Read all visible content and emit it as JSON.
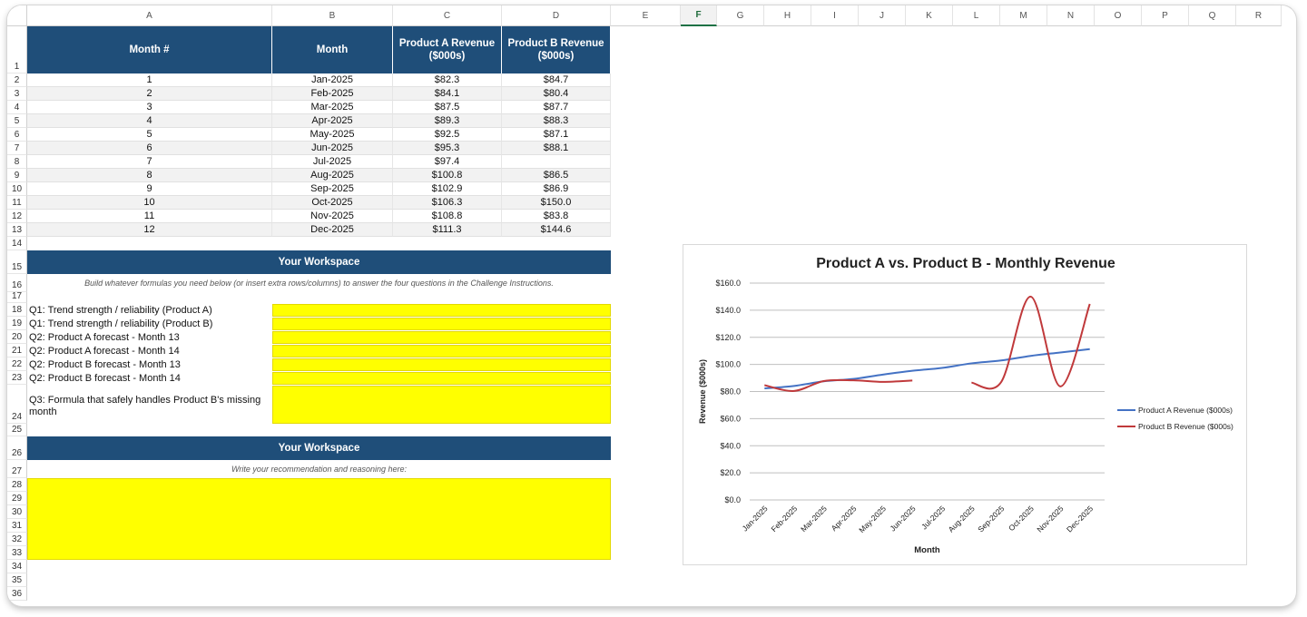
{
  "columns": [
    "A",
    "B",
    "C",
    "D",
    "E",
    "F",
    "G",
    "H",
    "I",
    "J",
    "K",
    "L",
    "M",
    "N",
    "O",
    "P",
    "Q",
    "R"
  ],
  "selected_column": "F",
  "rows": [
    "1",
    "2",
    "3",
    "4",
    "5",
    "6",
    "7",
    "8",
    "9",
    "10",
    "11",
    "12",
    "13",
    "14",
    "15",
    "16",
    "17",
    "18",
    "19",
    "20",
    "21",
    "22",
    "23",
    "24",
    "25",
    "26",
    "27",
    "28",
    "29",
    "30",
    "31",
    "32",
    "33",
    "34",
    "35",
    "36"
  ],
  "table": {
    "headers": [
      "Month #",
      "Month",
      "Product A Revenue ($000s)",
      "Product B Revenue ($000s)"
    ],
    "rows": [
      [
        "1",
        "Jan-2025",
        "$82.3",
        "$84.7"
      ],
      [
        "2",
        "Feb-2025",
        "$84.1",
        "$80.4"
      ],
      [
        "3",
        "Mar-2025",
        "$87.5",
        "$87.7"
      ],
      [
        "4",
        "Apr-2025",
        "$89.3",
        "$88.3"
      ],
      [
        "5",
        "May-2025",
        "$92.5",
        "$87.1"
      ],
      [
        "6",
        "Jun-2025",
        "$95.3",
        "$88.1"
      ],
      [
        "7",
        "Jul-2025",
        "$97.4",
        ""
      ],
      [
        "8",
        "Aug-2025",
        "$100.8",
        "$86.5"
      ],
      [
        "9",
        "Sep-2025",
        "$102.9",
        "$86.9"
      ],
      [
        "10",
        "Oct-2025",
        "$106.3",
        "$150.0"
      ],
      [
        "11",
        "Nov-2025",
        "$108.8",
        "$83.8"
      ],
      [
        "12",
        "Dec-2025",
        "$111.3",
        "$144.6"
      ]
    ]
  },
  "workspace1": {
    "title": "Your Workspace",
    "note": "Build whatever formulas you need below (or insert extra rows/columns) to answer the four questions in the Challenge Instructions.",
    "questions": [
      "Q1: Trend strength / reliability (Product A)",
      "Q1: Trend strength / reliability (Product B)",
      "Q2: Product A forecast - Month 13",
      "Q2: Product A forecast - Month 14",
      "Q2: Product B forecast - Month 13",
      "Q2: Product B forecast - Month 14",
      "Q3: Formula that safely handles Product B's missing month"
    ]
  },
  "workspace2": {
    "title": "Your Workspace",
    "note": "Write your recommendation and reasoning here:"
  },
  "chart_data": {
    "type": "line",
    "title": "Product A vs. Product B - Monthly Revenue",
    "xlabel": "Month",
    "ylabel": "Revenue ($000s)",
    "categories": [
      "Jan-2025",
      "Feb-2025",
      "Mar-2025",
      "Apr-2025",
      "May-2025",
      "Jun-2025",
      "Jul-2025",
      "Aug-2025",
      "Sep-2025",
      "Oct-2025",
      "Nov-2025",
      "Dec-2025"
    ],
    "series": [
      {
        "name": "Product A Revenue ($000s)",
        "color": "#4472c4",
        "values": [
          82.3,
          84.1,
          87.5,
          89.3,
          92.5,
          95.3,
          97.4,
          100.8,
          102.9,
          106.3,
          108.8,
          111.3
        ]
      },
      {
        "name": "Product B Revenue ($000s)",
        "color": "#c0393b",
        "values": [
          84.7,
          80.4,
          87.7,
          88.3,
          87.1,
          88.1,
          null,
          86.5,
          86.9,
          150.0,
          83.8,
          144.6
        ]
      }
    ],
    "ylim": [
      0,
      160
    ],
    "yticks": [
      "$0.0",
      "$20.0",
      "$40.0",
      "$60.0",
      "$80.0",
      "$100.0",
      "$120.0",
      "$140.0",
      "$160.0"
    ],
    "smooth": true,
    "grid": true,
    "legend": "right"
  },
  "colors": {
    "header": "#1f4e79",
    "input": "#ffff00",
    "alt_row": "#f2f2f2"
  }
}
